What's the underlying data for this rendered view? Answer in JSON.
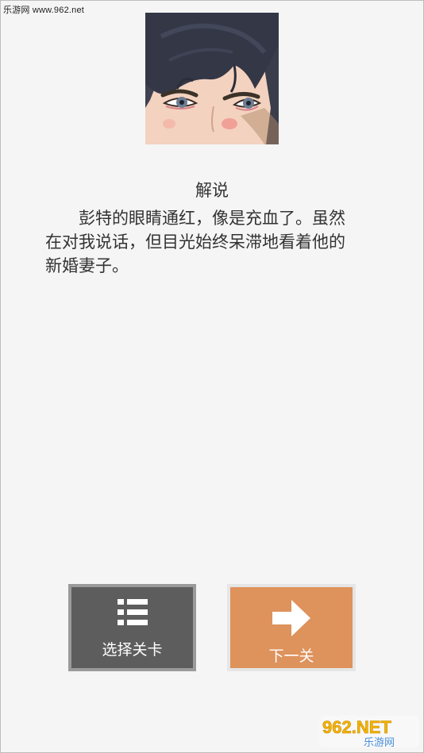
{
  "watermark": {
    "top_text": "乐游网 www.962.net",
    "logo_text": "962.NET",
    "logo_subtext": "乐游网"
  },
  "portrait": {
    "subject": "male character face closeup",
    "icon": "character-portrait"
  },
  "narration": {
    "title": "解说",
    "text": "彭特的眼睛通红，像是充血了。虽然在对我说话，但目光始终呆滞地看着他的新婚妻子。"
  },
  "buttons": {
    "select_level": {
      "label": "选择关卡",
      "icon": "list-icon"
    },
    "next_level": {
      "label": "下一关",
      "icon": "arrow-right-icon"
    }
  },
  "colors": {
    "background": "#f5f5f5",
    "select_button": "#5d5d5d",
    "next_button": "#de925c",
    "text": "#333333"
  }
}
